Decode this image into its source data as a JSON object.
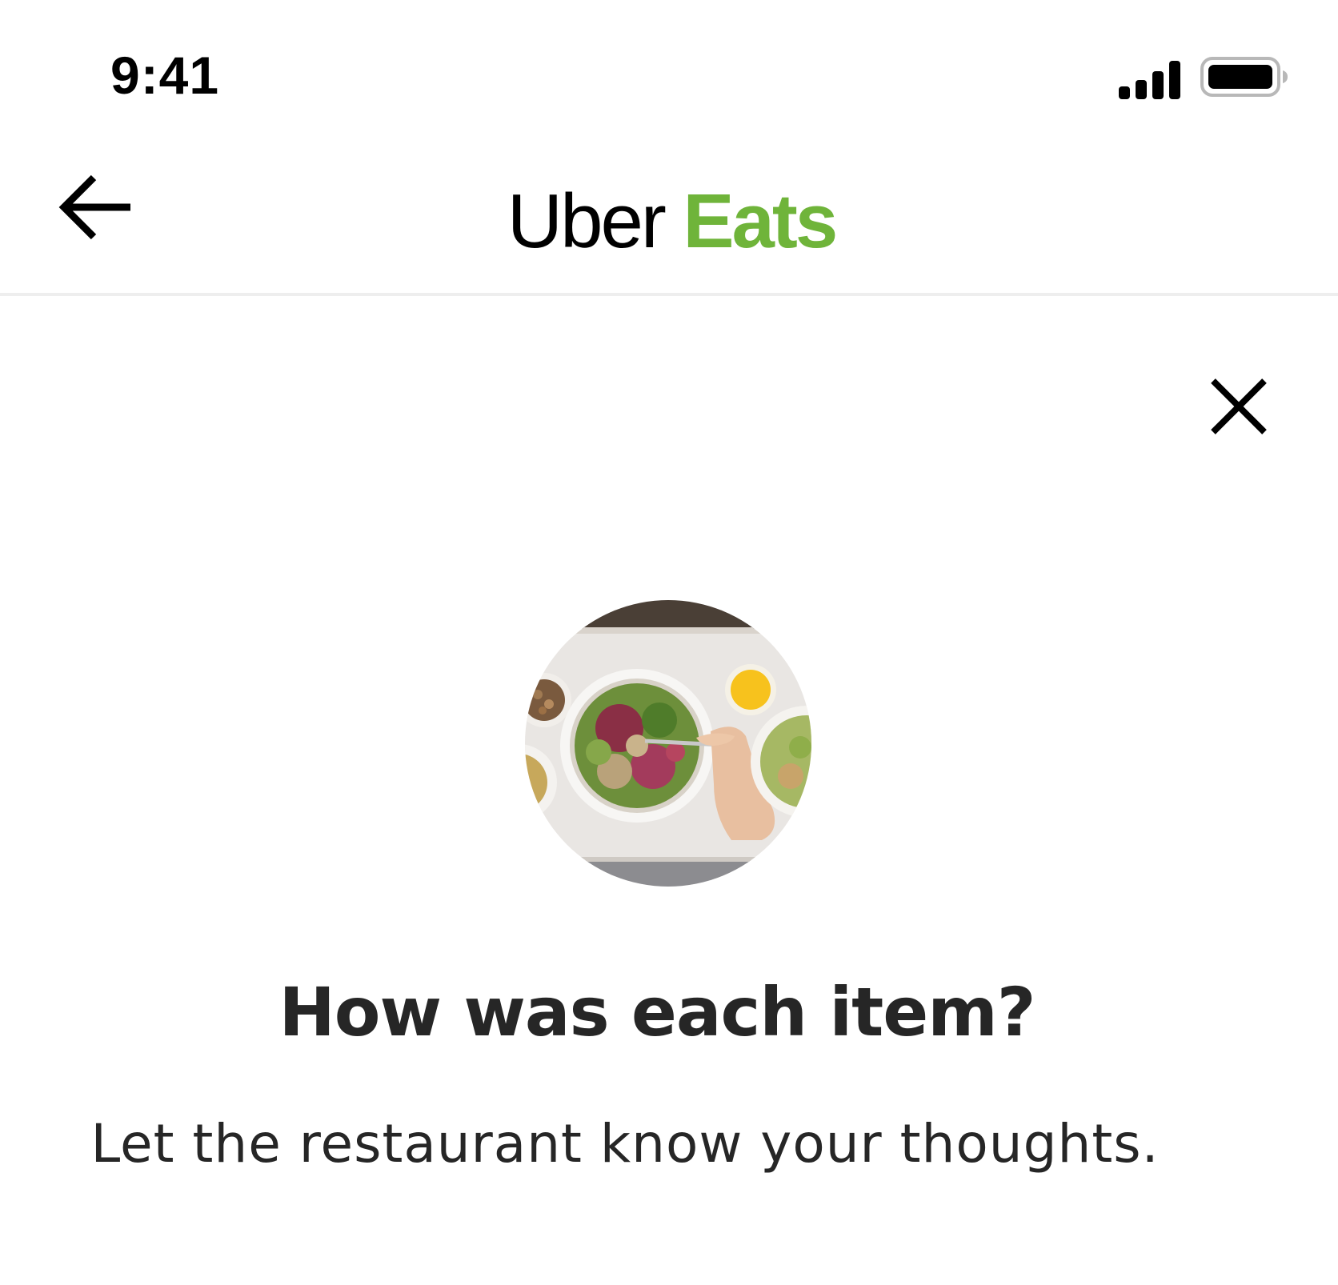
{
  "status_bar": {
    "time": "9:41",
    "signal_icon": "cellular-signal-icon",
    "battery_icon": "battery-full-icon"
  },
  "nav": {
    "back_icon": "arrow-left-icon",
    "logo_uber": "Uber",
    "logo_eats": "Eats",
    "logo_eats_color": "#6fb43a"
  },
  "dialog": {
    "close_icon": "close-icon",
    "image": "salad-bowl-photo",
    "title": "How was each item?",
    "subtitle": "Let the restaurant know your thoughts."
  }
}
